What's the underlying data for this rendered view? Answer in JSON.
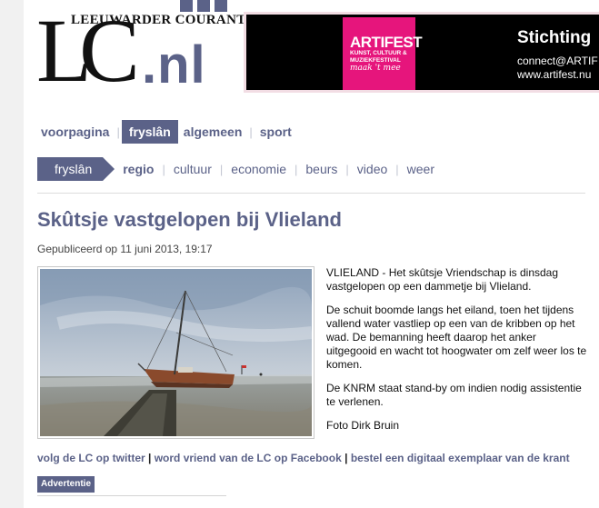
{
  "logo": {
    "name": "LEEUWARDER COURANT",
    "lc": "LC",
    "domain": ".nl"
  },
  "banner": {
    "artifest": {
      "title": "ARTIFEST",
      "subtitle_line1": "KUNST, CULTUUR &",
      "subtitle_line2": "MUZIEKFESTIVAL",
      "script": "maak 't mee"
    },
    "title": "Stichting",
    "email": "connect@ARTIF",
    "url": "www.artifest.nu"
  },
  "main_nav": [
    "voorpagina",
    "fryslân",
    "algemeen",
    "sport"
  ],
  "main_nav_active": "fryslân",
  "sub_nav": {
    "section": "fryslân",
    "items": [
      "regio",
      "cultuur",
      "economie",
      "beurs",
      "video",
      "weer"
    ],
    "active": "regio"
  },
  "article": {
    "title": "Skûtsje vastgelopen bij Vlieland",
    "published": "Gepubliceerd op 11 juni 2013, 19:17",
    "paragraphs": [
      "VLIELAND - Het skûtsje Vriendschap is dinsdag vastgelopen op een dammetje bij Vlieland.",
      "De schuit boomde langs het eiland, toen het tijdens vallend water vastliep op een van de kribben op het wad. De bemanning heeft daarop het anker uitgegooid en wacht tot hoogwater om zelf weer los te komen.",
      "De KNRM staat stand-by om indien nodig assistentie te verlenen.",
      "Foto Dirk Bruin"
    ]
  },
  "social": {
    "twitter": "volg de LC op twitter",
    "facebook": "word vriend van de LC op Facebook",
    "digital": "bestel een digitaal exemplaar van de krant",
    "separator": "|"
  },
  "ad_label": "Advertentie",
  "colors": {
    "brand": "#5b6288",
    "banner_pink": "#e6157c"
  }
}
